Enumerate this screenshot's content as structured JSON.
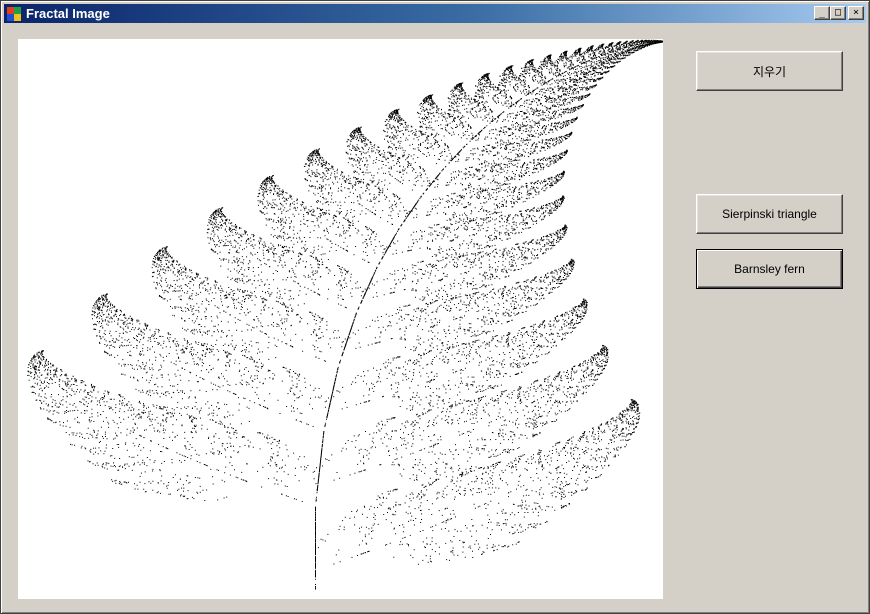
{
  "window": {
    "title": "Fractal Image",
    "icon": "form-icon",
    "controls": {
      "minimize": "_",
      "maximize": "□",
      "close": "×"
    }
  },
  "buttons": {
    "clear": "지우기",
    "sierpinski": "Sierpinski triangle",
    "barnsley": "Barnsley fern"
  },
  "canvas": {
    "content": "barnsley-fern",
    "background": "#ffffff",
    "ink": "#000000"
  }
}
